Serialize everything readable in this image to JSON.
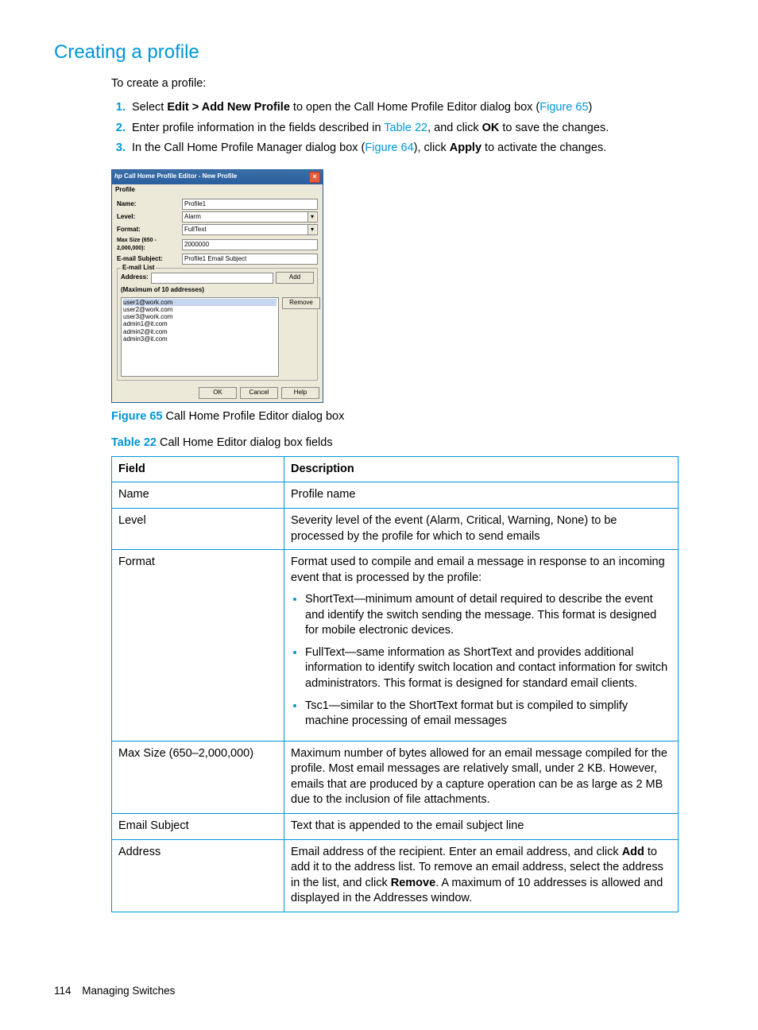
{
  "section_title": "Creating a profile",
  "intro": "To create a profile:",
  "steps": {
    "s1": {
      "pre": "Select ",
      "bold1": "Edit > Add New Profile",
      "mid": " to open the Call Home Profile Editor dialog box (",
      "link": "Figure 65",
      "post": ")"
    },
    "s2": {
      "pre": "Enter profile information in the fields described in ",
      "link": "Table 22",
      "mid": ", and click ",
      "bold1": "OK",
      "post": " to save the changes."
    },
    "s3": {
      "pre": "In the Call Home Profile Manager dialog box (",
      "link": "Figure 64",
      "mid": "), click ",
      "bold1": "Apply",
      "post": " to activate the changes."
    }
  },
  "dialog": {
    "title": "Call Home Profile Editor - New Profile",
    "menu": "Profile",
    "labels": {
      "name": "Name:",
      "level": "Level:",
      "format": "Format:",
      "max": "Max Size (650 - 2,000,000):",
      "subject": "E-mail Subject:"
    },
    "values": {
      "name": "Profile1",
      "level": "Alarm",
      "format": "FullText",
      "max": "2000000",
      "subject": "Profile1 Email Subject"
    },
    "group_title": "E-mail List",
    "address_label": "Address:",
    "add_btn": "Add",
    "note": "(Maximum of 10 addresses)",
    "remove_btn": "Remove",
    "emails": [
      "user1@work.com",
      "user2@work.com",
      "user3@work.com",
      "admin1@it.com",
      "admin2@it.com",
      "admin3@it.com"
    ],
    "footer": {
      "ok": "OK",
      "cancel": "Cancel",
      "help": "Help"
    }
  },
  "fig_caption": {
    "label": "Figure 65",
    "text": " Call Home Profile Editor dialog box"
  },
  "tbl_caption": {
    "label": "Table 22",
    "text": "   Call Home Editor dialog box fields"
  },
  "table": {
    "h1": "Field",
    "h2": "Description",
    "rows": {
      "name": {
        "f": "Name",
        "d": "Profile name"
      },
      "level": {
        "f": "Level",
        "d": "Severity level of the event (Alarm, Critical, Warning, None) to be processed by the profile for which to send emails"
      },
      "format": {
        "f": "Format",
        "d": "Format used to compile and email a message in response to an incoming event that is processed by the profile:",
        "b1": "ShortText—minimum amount of detail required to describe the event and identify the switch sending the message. This format is designed for mobile electronic devices.",
        "b2": "FullText—same information as ShortText and provides additional information to identify switch location and contact information for switch administrators. This format is designed for standard email clients.",
        "b3": "Tsc1—similar to the ShortText format but is compiled to simplify machine processing of email messages"
      },
      "max": {
        "f": "Max Size (650–2,000,000)",
        "d": "Maximum number of bytes allowed for an email message compiled for the profile. Most email messages are relatively small, under 2 KB. However, emails that are produced by a capture operation can be as large as 2 MB due to the inclusion of file attachments."
      },
      "subject": {
        "f": "Email Subject",
        "d": "Text that is appended to the email subject line"
      },
      "address": {
        "f": "Address",
        "d1": "Email address of the recipient. Enter an email address, and click ",
        "b1": "Add",
        "d2": " to add it to the address list. To remove an email address, select the address in the list, and click ",
        "b2": "Remove",
        "d3": ". A maximum of 10 addresses is allowed and displayed in the Addresses window."
      }
    }
  },
  "footer": {
    "page": "114",
    "section": "Managing Switches"
  }
}
